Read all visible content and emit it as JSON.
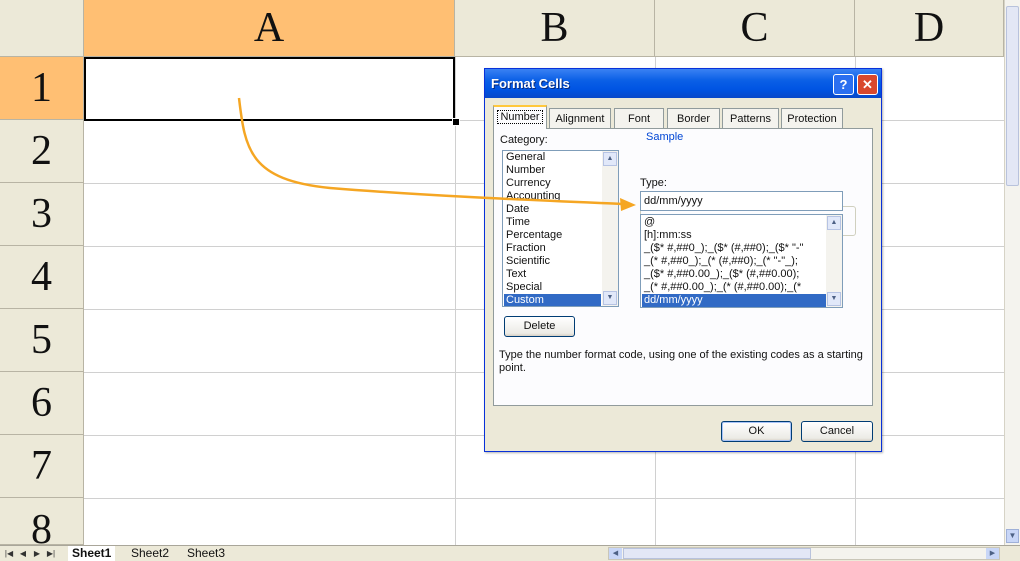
{
  "sheet": {
    "columns": [
      "A",
      "B",
      "C",
      "D"
    ],
    "rows": [
      "1",
      "2",
      "3",
      "4",
      "5",
      "6",
      "7",
      "8"
    ],
    "selected_column": "A",
    "selected_row": "1",
    "tabs": [
      "Sheet1",
      "Sheet2",
      "Sheet3"
    ],
    "active_tab": "Sheet1"
  },
  "dialog": {
    "title": "Format Cells",
    "help_label": "?",
    "close_label": "✕",
    "tabs": [
      "Number",
      "Alignment",
      "Font",
      "Border",
      "Patterns",
      "Protection"
    ],
    "active_tab": "Number",
    "category_label": "Category:",
    "categories": [
      "General",
      "Number",
      "Currency",
      "Accounting",
      "Date",
      "Time",
      "Percentage",
      "Fraction",
      "Scientific",
      "Text",
      "Special",
      "Custom"
    ],
    "selected_category": "Custom",
    "sample_label": "Sample",
    "type_label": "Type:",
    "type_value": "dd/mm/yyyy",
    "type_list": [
      "@",
      "[h]:mm:ss",
      "_($* #,##0_);_($* (#,##0);_($* \"-\"",
      "_(* #,##0_);_(* (#,##0);_(* \"-\"_);",
      "_($* #,##0.00_);_($* (#,##0.00);",
      "_(* #,##0.00_);_(* (#,##0.00);_(*",
      "dd/mm/yyyy"
    ],
    "selected_type": "dd/mm/yyyy",
    "delete_label": "Delete",
    "description": "Type the number format code, using one of the existing codes as a starting point.",
    "ok_label": "OK",
    "cancel_label": "Cancel"
  },
  "colors": {
    "selected_header": "#FFBF73",
    "annotation_arrow": "#F5A623",
    "titlebar": "#0054E3",
    "selection": "#316AC5"
  },
  "icons": [
    "first-sheet-icon",
    "prev-sheet-icon",
    "next-sheet-icon",
    "last-sheet-icon",
    "scroll-up-icon",
    "scroll-down-icon",
    "scroll-left-icon",
    "scroll-right-icon",
    "annotation-arrow-icon"
  ]
}
